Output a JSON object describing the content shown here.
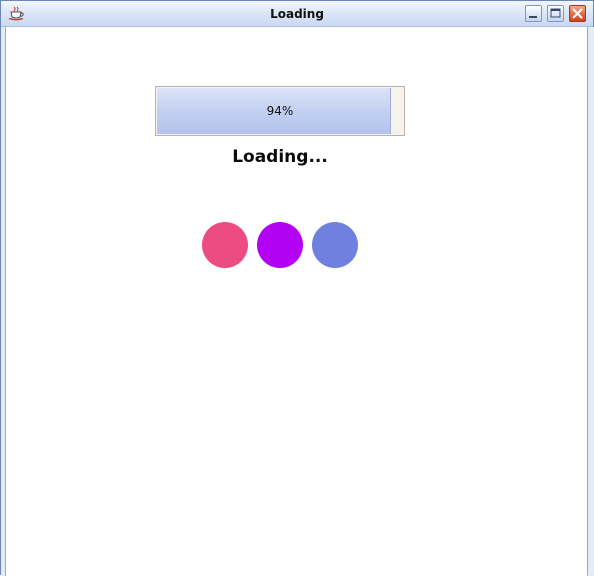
{
  "window": {
    "title": "Loading"
  },
  "progress": {
    "percent": 94,
    "label": "94%"
  },
  "status": {
    "text": "Loading..."
  },
  "dots": [
    {
      "color": "#ec4c82"
    },
    {
      "color": "#b301f4"
    },
    {
      "color": "#6f80df"
    }
  ],
  "colors": {
    "titlebar": "#dde7f7",
    "progress_fill": "#c3d0f1",
    "progress_track": "#f6f2ec",
    "close_button": "#e06a3e"
  }
}
